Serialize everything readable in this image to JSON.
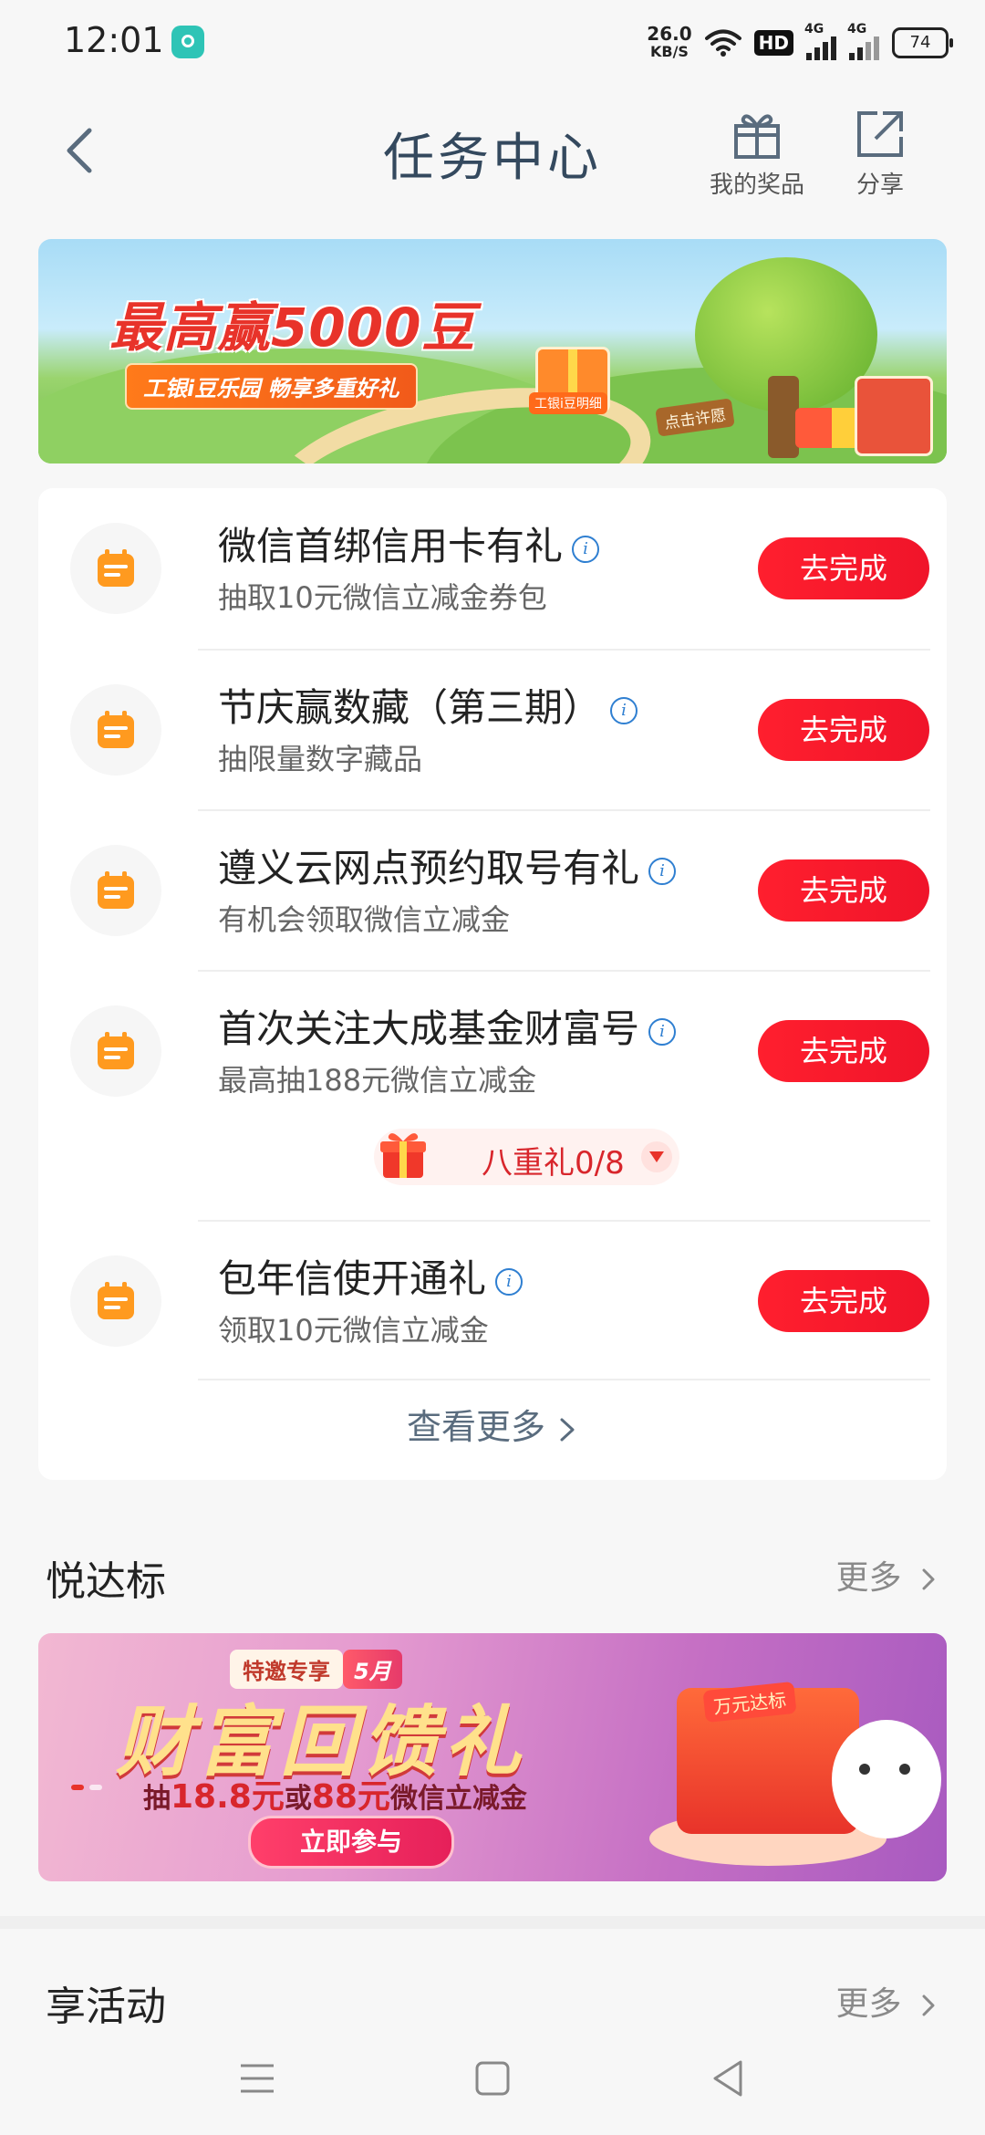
{
  "status_bar": {
    "time": "12:01",
    "net_speed_value": "26.0",
    "net_speed_unit": "KB/S",
    "hd_label": "HD",
    "signal_1_label": "4G",
    "signal_2_label": "4G",
    "battery": "74"
  },
  "header": {
    "title": "任务中心",
    "prizes_label": "我的奖品",
    "share_label": "分享"
  },
  "top_banner": {
    "title": "最高赢5000豆",
    "subtitle": "工银i豆乐园 畅享多重好礼",
    "gift_label": "工银i豆明细",
    "sign_label": "点击许愿"
  },
  "tasks": [
    {
      "title": "微信首绑信用卡有礼",
      "subtitle": "抽取10元微信立减金券包",
      "button": "去完成"
    },
    {
      "title": "节庆赢数藏（第三期）",
      "subtitle": "抽限量数字藏品",
      "button": "去完成"
    },
    {
      "title": "遵义云网点预约取号有礼",
      "subtitle": "有机会领取微信立减金",
      "button": "去完成"
    },
    {
      "title": "首次关注大成基金财富号",
      "subtitle": "最高抽188元微信立减金",
      "button": "去完成"
    },
    {
      "title": "包年信使开通礼",
      "subtitle": "领取10元微信立减金",
      "button": "去完成"
    }
  ],
  "gift_progress": {
    "label": "八重礼0/8"
  },
  "view_more": "查看更多",
  "section_1": {
    "title": "悦达标",
    "more": "更多"
  },
  "promo_banner": {
    "badge": "特邀专享",
    "month": "5月",
    "title": "财富回馈礼",
    "sub_prefix": "抽",
    "amount_1": "18.8元",
    "sub_or": "或",
    "amount_2": "88元",
    "sub_suffix": "微信立减金",
    "cta": "立即参与",
    "gift_label": "万元达标"
  },
  "section_2": {
    "title": "享活动",
    "more": "更多"
  },
  "colors": {
    "accent_red": "#f0142a",
    "task_icon_orange": "#ff9a1f",
    "title_slate": "#34495e",
    "info_blue": "#2f7fd1"
  },
  "icons": {
    "back": "chevron-left-icon",
    "prizes": "gift-icon",
    "share": "share-icon",
    "task": "calendar-icon",
    "info": "info-icon",
    "more": "chevron-right-icon"
  }
}
